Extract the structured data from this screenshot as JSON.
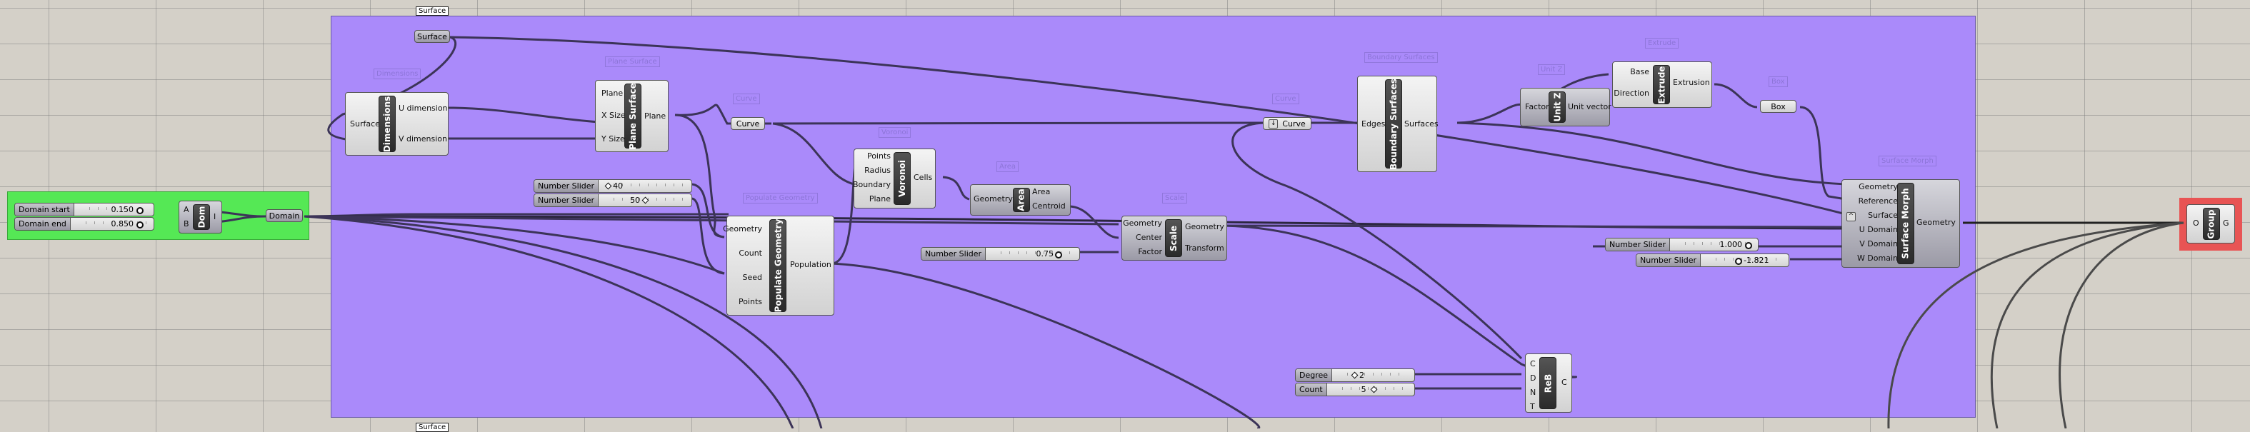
{
  "canvas": {
    "colors": {
      "background": "#d4d0c8",
      "group_main": "#aa8afa",
      "group_domain": "#55e855",
      "group_output": "#e85454",
      "wire": "#3c3458"
    }
  },
  "groups": [
    {
      "id": "main",
      "color": "#aa8afa"
    },
    {
      "id": "domain",
      "color": "#55e855"
    },
    {
      "id": "output",
      "color": "#e85454"
    }
  ],
  "tags": {
    "top": "Surface",
    "bottom": "Surface"
  },
  "domain_group": {
    "sliders": [
      {
        "label": "Domain start",
        "value": "0.150"
      },
      {
        "label": "Domain end",
        "value": "0.850"
      }
    ],
    "component": {
      "nickname": "Dom",
      "inputs": [
        "A",
        "B"
      ],
      "outputs": [
        "I"
      ]
    },
    "param": {
      "label": "Domain"
    }
  },
  "nodes": {
    "surface_param": {
      "label": "Surface"
    },
    "dimensions": {
      "bubble": "Dimensions",
      "nickname": "Dimensions",
      "inputs": [
        "Surface"
      ],
      "outputs": [
        "U dimension",
        "V dimension"
      ]
    },
    "plane_surface": {
      "bubble": "Plane Surface",
      "nickname": "Plane Surface",
      "inputs": [
        "Plane",
        "X Size",
        "Y Size"
      ],
      "outputs": [
        "Plane"
      ]
    },
    "curve1": {
      "bubble": "Curve",
      "label": "Curve"
    },
    "sliders_pop": [
      {
        "label": "Number Slider",
        "value": "40"
      },
      {
        "label": "Number Slider",
        "value": "50"
      }
    ],
    "populate": {
      "bubble": "Populate Geometry",
      "nickname": "Populate Geometry",
      "inputs": [
        "Geometry",
        "Count",
        "Seed",
        "Points"
      ],
      "outputs": [
        "Population"
      ]
    },
    "voronoi": {
      "bubble": "Voronoi",
      "nickname": "Voronoi",
      "inputs": [
        "Points",
        "Radius",
        "Boundary",
        "Plane"
      ],
      "outputs": [
        "Cells"
      ]
    },
    "area": {
      "bubble": "Area",
      "nickname": "Area",
      "inputs": [
        "Geometry"
      ],
      "outputs": [
        "Area",
        "Centroid"
      ]
    },
    "scale_slider": {
      "label": "Number Slider",
      "value": "0.75"
    },
    "scale": {
      "bubble": "Scale",
      "nickname": "Scale",
      "inputs": [
        "Geometry",
        "Center",
        "Factor"
      ],
      "outputs": [
        "Geometry",
        "Transform"
      ]
    },
    "curve2": {
      "bubble": "Curve",
      "label": "Curve",
      "icon": "flatten-icon"
    },
    "boundary": {
      "bubble": "Boundary Surfaces",
      "nickname": "Boundary Surfaces",
      "inputs": [
        "Edges"
      ],
      "outputs": [
        "Surfaces"
      ]
    },
    "unitz": {
      "bubble": "Unit Z",
      "nickname": "Unit Z",
      "inputs": [
        "Factor"
      ],
      "outputs": [
        "Unit vector"
      ]
    },
    "extrude": {
      "bubble": "Extrude",
      "nickname": "Extrude",
      "inputs": [
        "Base",
        "Direction"
      ],
      "outputs": [
        "Extrusion"
      ]
    },
    "box": {
      "bubble": "Box",
      "label": "Box"
    },
    "morph_sliders": [
      {
        "label": "Number Slider",
        "value": "1.000"
      },
      {
        "label": "Number Slider",
        "value": "-1.821"
      }
    ],
    "surface_morph": {
      "bubble": "Surface Morph",
      "nickname": "Surface Morph",
      "inputs": [
        "Geometry",
        "Reference",
        "Surface",
        "U Domain",
        "V Domain",
        "W Domain"
      ],
      "outputs": [
        "Geometry"
      ]
    },
    "rebuild_sliders": [
      {
        "label": "Degree",
        "value": "2"
      },
      {
        "label": "Count",
        "value": "5"
      }
    ],
    "rebuild": {
      "nickname": "ReB",
      "inputs": [
        "C",
        "D",
        "N",
        "T"
      ],
      "outputs": [
        "C"
      ]
    },
    "group_comp": {
      "nickname": "Group",
      "inputs": [
        "O"
      ],
      "outputs": [
        "G"
      ]
    }
  }
}
